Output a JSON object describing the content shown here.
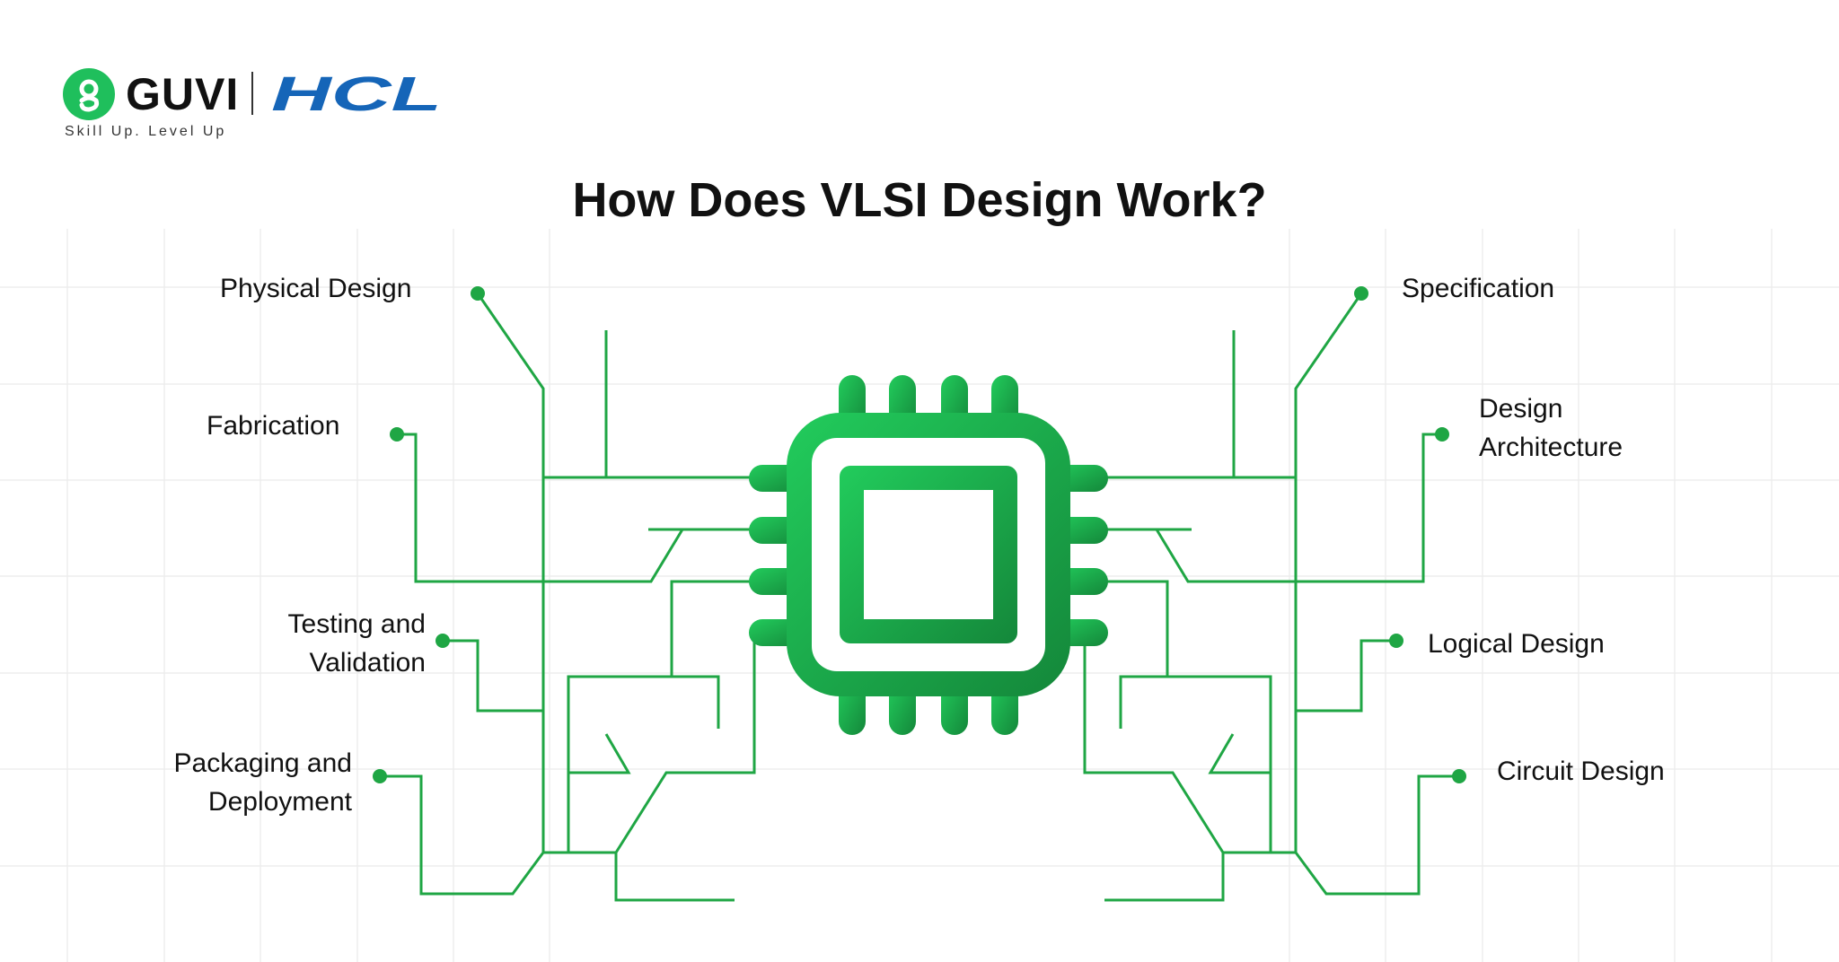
{
  "brand": {
    "name": "GUVI",
    "partner": "HCL",
    "tagline": "Skill Up. Level Up"
  },
  "title": "How Does VLSI Design Work?",
  "steps_left": [
    {
      "id": "physical-design",
      "label": "Physical Design"
    },
    {
      "id": "fabrication",
      "label": "Fabrication"
    },
    {
      "id": "testing-validation",
      "line1": "Testing and",
      "line2": "Validation"
    },
    {
      "id": "packaging-deployment",
      "line1": "Packaging and",
      "line2": "Deployment"
    }
  ],
  "steps_right": [
    {
      "id": "specification",
      "label": "Specification"
    },
    {
      "id": "design-architecture",
      "line1": "Design",
      "line2": "Architecture"
    },
    {
      "id": "logical-design",
      "label": "Logical Design"
    },
    {
      "id": "circuit-design",
      "label": "Circuit Design"
    }
  ],
  "colors": {
    "accent": "#1fa644",
    "chip_light": "#22c55e",
    "chip_dark": "#16893a",
    "grid": "#ececec",
    "hcl_blue": "#1565b8",
    "text": "#111111"
  },
  "icons": {
    "chip": "chip-icon",
    "logo": "guvi-logo-icon"
  }
}
